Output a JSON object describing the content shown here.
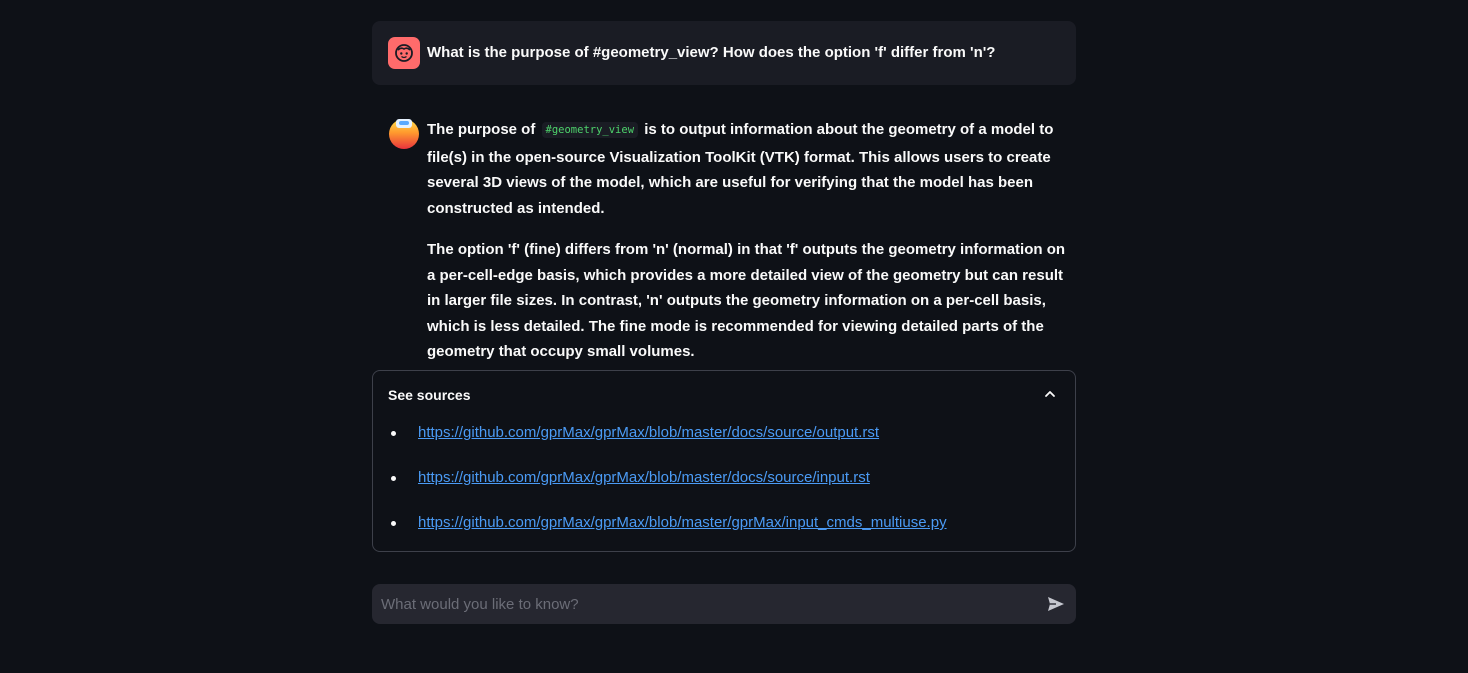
{
  "chat": {
    "user_message": "What is the purpose of #geometry_view? How does the option 'f' differ from 'n'?",
    "assistant": {
      "p1_before": "The purpose of",
      "p1_code": "#geometry_view",
      "p1_after": "is to output information about the geometry of a model to file(s) in the open-source Visualization ToolKit (VTK) format. This allows users to create several 3D views of the model, which are useful for verifying that the model has been constructed as intended.",
      "p2": "The option 'f' (fine) differs from 'n' (normal) in that 'f' outputs the geometry information on a per-cell-edge basis, which provides a more detailed view of the geometry but can result in larger file sizes. In contrast, 'n' outputs the geometry information on a per-cell basis, which is less detailed. The fine mode is recommended for viewing detailed parts of the geometry that occupy small volumes."
    }
  },
  "sources": {
    "title": "See sources",
    "links": [
      "https://github.com/gprMax/gprMax/blob/master/docs/source/output.rst",
      "https://github.com/gprMax/gprMax/blob/master/docs/source/input.rst",
      "https://github.com/gprMax/gprMax/blob/master/gprMax/input_cmds_multiuse.py"
    ]
  },
  "input": {
    "placeholder": "What would you like to know?"
  },
  "icons": {
    "user_avatar": "user-face-icon",
    "assistant_avatar": "robot-avatar-icon",
    "collapse": "chevron-up-icon",
    "send": "send-icon"
  },
  "colors": {
    "background": "#0e1117",
    "user_bubble": "#1a1c24",
    "user_avatar": "#ff6b6b",
    "link": "#4b9bf5",
    "code": "#4dd26b",
    "input_bg": "#262730"
  }
}
